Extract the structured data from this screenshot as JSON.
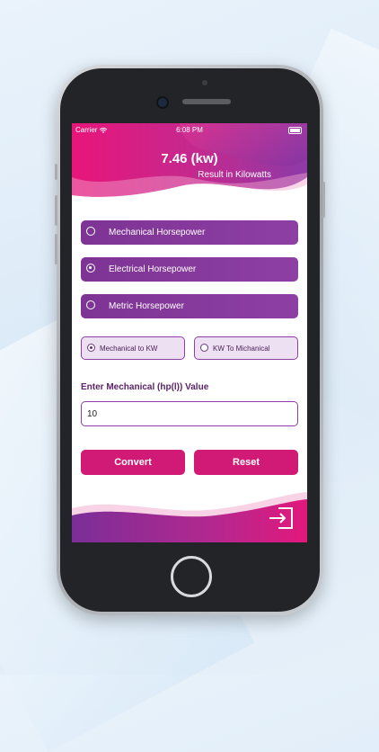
{
  "status": {
    "carrier": "Carrier",
    "time": "6:08 PM"
  },
  "result": {
    "value": "7.46 (kw)",
    "label": "Result in Kilowatts"
  },
  "options": [
    {
      "label": "Mechanical Horsepower",
      "selected": false
    },
    {
      "label": "Electrical Horsepower",
      "selected": true
    },
    {
      "label": "Metric Horsepower",
      "selected": false
    }
  ],
  "modes": [
    {
      "label": "Mechanical to KW",
      "selected": true
    },
    {
      "label": "KW To Michanical",
      "selected": false
    }
  ],
  "input": {
    "label": "Enter Mechanical (hp(l)) Value",
    "value": "10"
  },
  "buttons": {
    "convert": "Convert",
    "reset": "Reset"
  },
  "icons": {
    "exit": "exit-icon",
    "wifi": "wifi-icon",
    "battery": "battery-icon"
  },
  "colors": {
    "accent_pink": "#d11a76",
    "accent_purple": "#8e3fa4",
    "header_pink": "#e0187a"
  }
}
